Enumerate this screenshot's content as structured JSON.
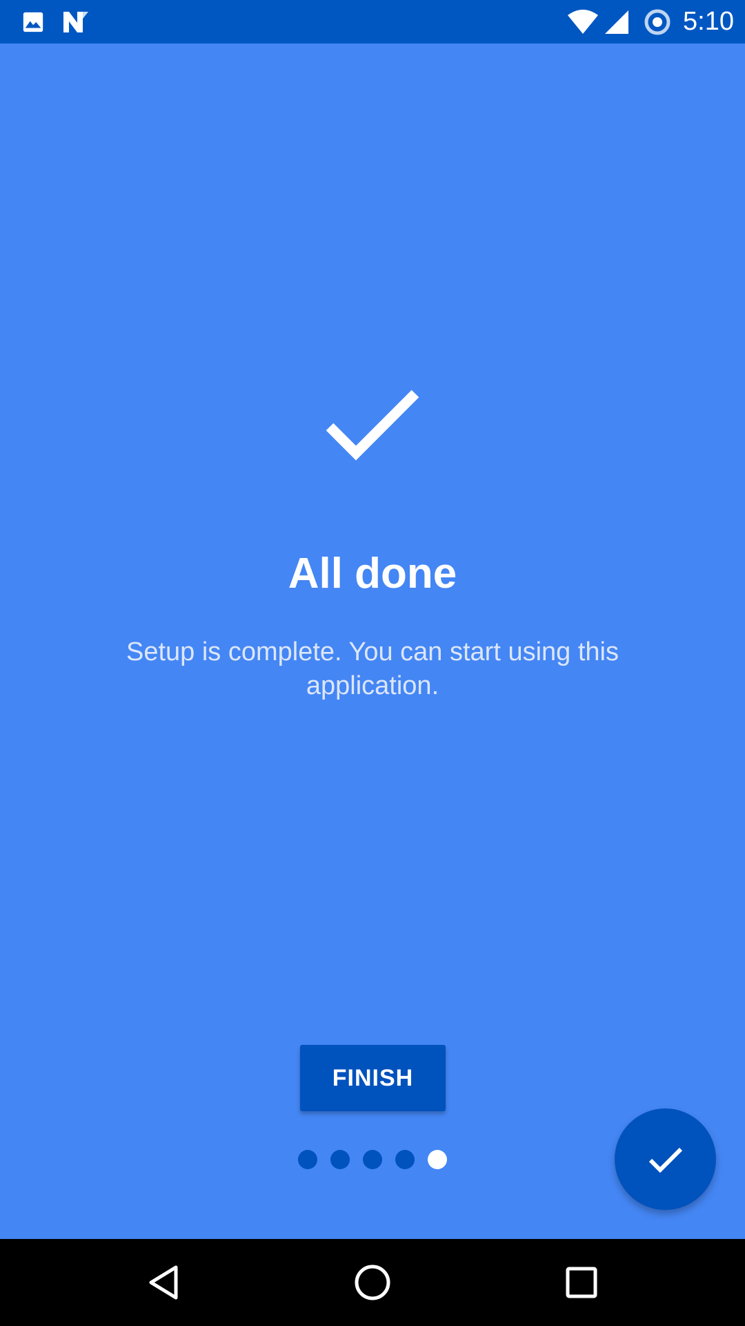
{
  "status_bar": {
    "time": "5:10",
    "icons": [
      "image-notification-icon",
      "n-app-notification-icon",
      "wifi-icon",
      "cellular-signal-icon",
      "sync-icon"
    ]
  },
  "content": {
    "hero_icon": "checkmark-icon",
    "title": "All done",
    "subtitle": "Setup is complete. You can start using this application."
  },
  "finish_label": "FINISH",
  "pager": {
    "total": 5,
    "current": 5
  },
  "fab_icon": "check-icon",
  "navigation": [
    "back-icon",
    "home-icon",
    "recents-icon"
  ],
  "colors": {
    "background": "#4486F4",
    "status_bar": "#0057C2",
    "accent_dark": "#0052BD",
    "text": "#FFFFFF"
  }
}
